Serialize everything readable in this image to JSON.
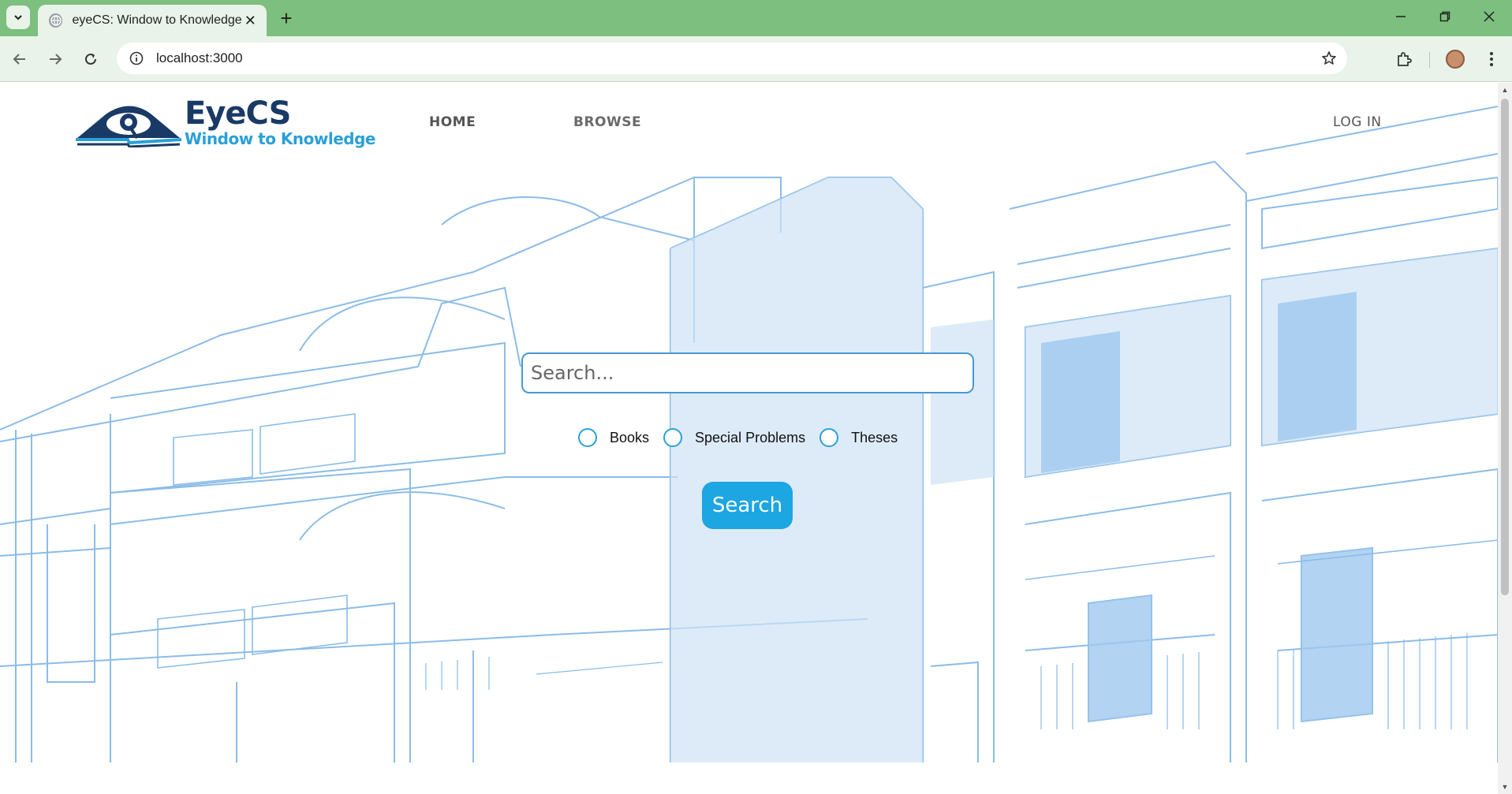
{
  "browser": {
    "tab_title": "eyeCS: Window to Knowledge",
    "url": "localhost:3000",
    "tab_close_glyph": "✕",
    "new_tab_glyph": "+"
  },
  "site": {
    "logo_title": "EyeCS",
    "logo_subtitle": "Window to Knowledge",
    "nav": {
      "home": "HOME",
      "browse": "BROWSE",
      "login": "LOG IN"
    },
    "search": {
      "placeholder": "Search...",
      "button_label": "Search",
      "options": [
        "Books",
        "Special Problems",
        "Theses"
      ]
    }
  },
  "colors": {
    "tabbar": "#7cbf7e",
    "toolbar": "#e9f3e9",
    "brand_dark": "#1a3a66",
    "brand_light": "#2aa0d8",
    "button": "#1ca6e2",
    "sketch": "#8bbce8"
  },
  "icons": {
    "tab_search": "chevron-down-icon",
    "favicon": "globe-icon",
    "back": "arrow-left-icon",
    "forward": "arrow-right-icon",
    "reload": "reload-icon",
    "site_info": "info-icon",
    "bookmark": "star-icon",
    "extensions": "puzzle-icon",
    "menu": "kebab-menu-icon"
  }
}
